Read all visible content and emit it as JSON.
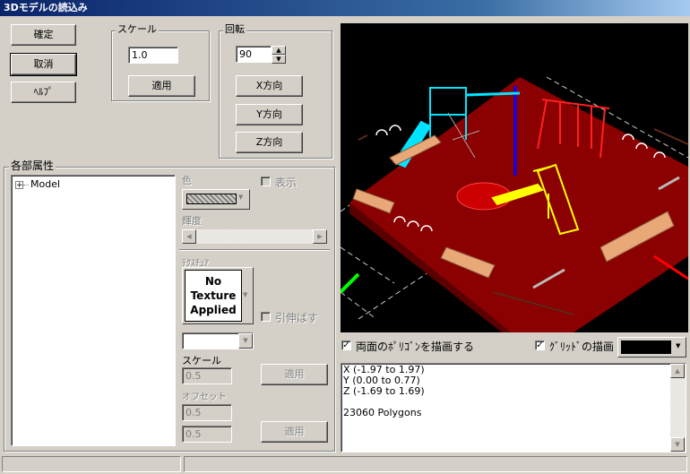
{
  "window": {
    "title": "3Dモデルの読込み"
  },
  "buttons": {
    "ok": "確定",
    "cancel": "取消",
    "help": "ﾍﾙﾌﾟ",
    "apply_scale": "適用",
    "x_dir": "X方向",
    "y_dir": "Y方向",
    "z_dir": "Z方向",
    "apply_tex_scale": "適用",
    "apply_offset": "適用"
  },
  "scale": {
    "legend": "スケール",
    "value": "1.0"
  },
  "rotation": {
    "legend": "回転",
    "value": "90"
  },
  "attributes": {
    "legend": "各部属性",
    "tree": [
      {
        "expander": "+",
        "label": "Model"
      }
    ],
    "color_label": "色",
    "show_label": "表示",
    "brightness_label": "輝度",
    "texture_label": "ﾃｸｽﾁｭｱ",
    "texture_preview": [
      "No",
      "Texture",
      "Applied"
    ],
    "stretch_label": "引伸ばす",
    "tex_scale_label": "スケール",
    "tex_scale_value": "0.5",
    "offset_label": "オフセット",
    "offset_x": "0.5",
    "offset_y": "0.5"
  },
  "viewport_options": {
    "both_faces": "両面のﾎﾟﾘｺﾞﾝを描画する",
    "both_faces_checked": true,
    "grid": "ｸﾞﾘｯﾄﾞの描画",
    "grid_checked": true,
    "bg_color": "#000000"
  },
  "info": {
    "lines": [
      "X (-1.97 to 1.97)",
      "Y (0.00 to 0.77)",
      "Z (-1.69 to 1.69)",
      "",
      "23060 Polygons"
    ]
  },
  "icons": {
    "dropdown": "chevron-down-icon",
    "spin_up": "spin-up-icon",
    "spin_down": "spin-down-icon",
    "scroll_left": "scroll-left-icon",
    "scroll_right": "scroll-right-icon",
    "scroll_up": "scroll-up-icon",
    "scroll_down": "scroll-down-icon",
    "check": "check-icon"
  },
  "colors": {
    "title_start": "#0a246a",
    "title_end": "#a6caf0",
    "face": "#d4d0c8",
    "floor": "#8b0000",
    "slide_cyan": "#00e5ff",
    "slide_yellow": "#ffff00",
    "bench": "#e8a878"
  }
}
